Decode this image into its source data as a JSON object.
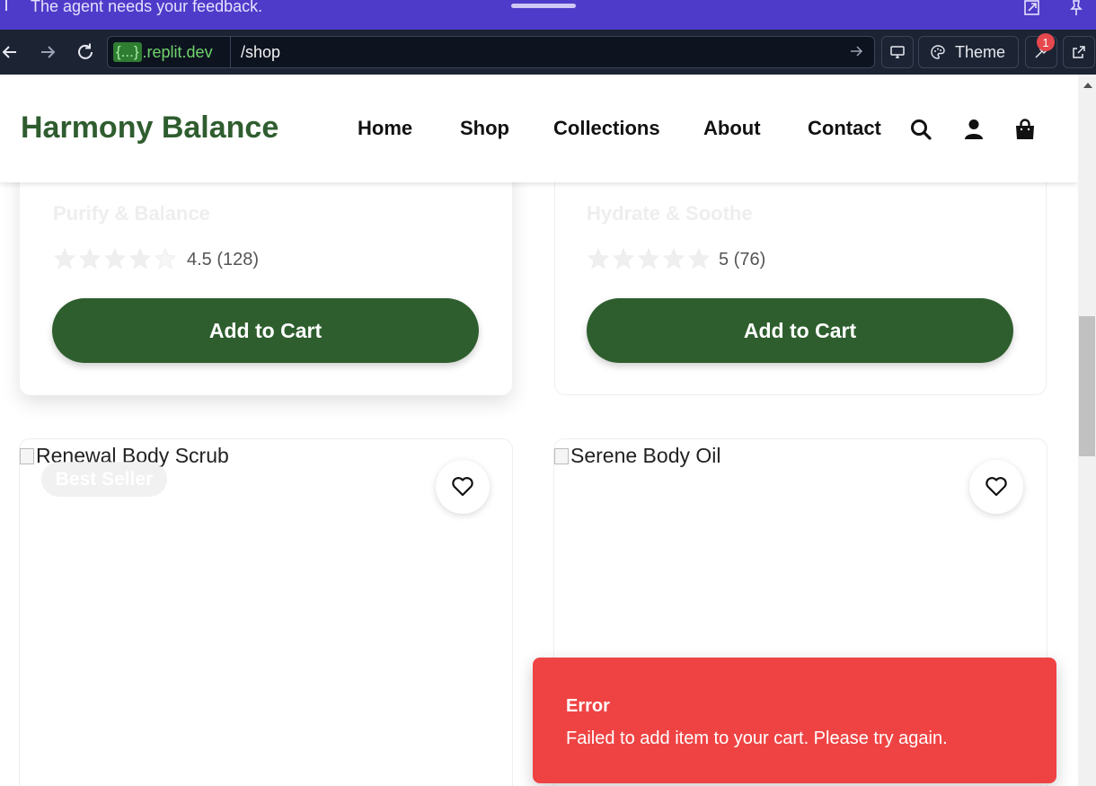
{
  "banner": {
    "message": "The agent needs your feedback.",
    "icons": [
      "grip-icon",
      "expand-icon",
      "pin-icon"
    ]
  },
  "browser": {
    "host_badge": "{...}",
    "host_text": ".replit.dev",
    "path": "/shop",
    "theme_label": "Theme",
    "notification_count": "1",
    "icons": [
      "back-arrow-icon",
      "forward-arrow-icon",
      "reload-icon",
      "go-arrow-icon",
      "devices-icon",
      "palette-icon",
      "wrench-icon",
      "open-external-icon"
    ]
  },
  "header": {
    "logo": "Harmony Balance",
    "nav": [
      "Home",
      "Shop",
      "Collections",
      "About",
      "Contact"
    ],
    "icons": [
      "search-icon",
      "account-icon",
      "cart-bag-icon"
    ]
  },
  "products_top": [
    {
      "subtitle": "Purify & Balance",
      "rating_text": "4.5 (128)",
      "rating": 4.5,
      "button": "Add to Cart"
    },
    {
      "subtitle": "Hydrate & Soothe",
      "rating_text": "5 (76)",
      "rating": 5,
      "button": "Add to Cart"
    }
  ],
  "products_bottom": [
    {
      "image_alt": "Renewal Body Scrub",
      "badge": "Best Seller"
    },
    {
      "image_alt": "Serene Body Oil"
    }
  ],
  "toast": {
    "title": "Error",
    "description": "Failed to add item to your cart. Please try again."
  },
  "colors": {
    "banner": "#4f3bc9",
    "chrome": "#1c2333",
    "brand_green": "#2e5e2e",
    "error_red": "#ef4343"
  }
}
